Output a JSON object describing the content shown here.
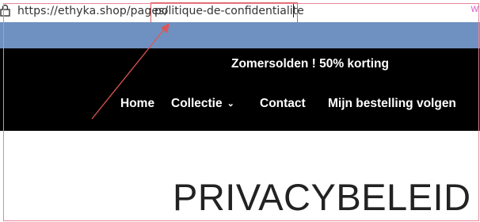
{
  "browser": {
    "url_base": "https://ethyka.shop/pages/",
    "url_path": "politique-de-confidentialite",
    "corner_mark": "w"
  },
  "header": {
    "promo": "Zomersolden ! 50% korting",
    "nav": [
      "Home",
      "Collectie",
      "Contact",
      "Mijn bestelling volgen"
    ]
  },
  "page": {
    "title": "PRIVACYBELEID"
  },
  "colors": {
    "blue_bar": "#6f91c1",
    "nav_bg": "#000000",
    "annotation": "#e05555"
  }
}
